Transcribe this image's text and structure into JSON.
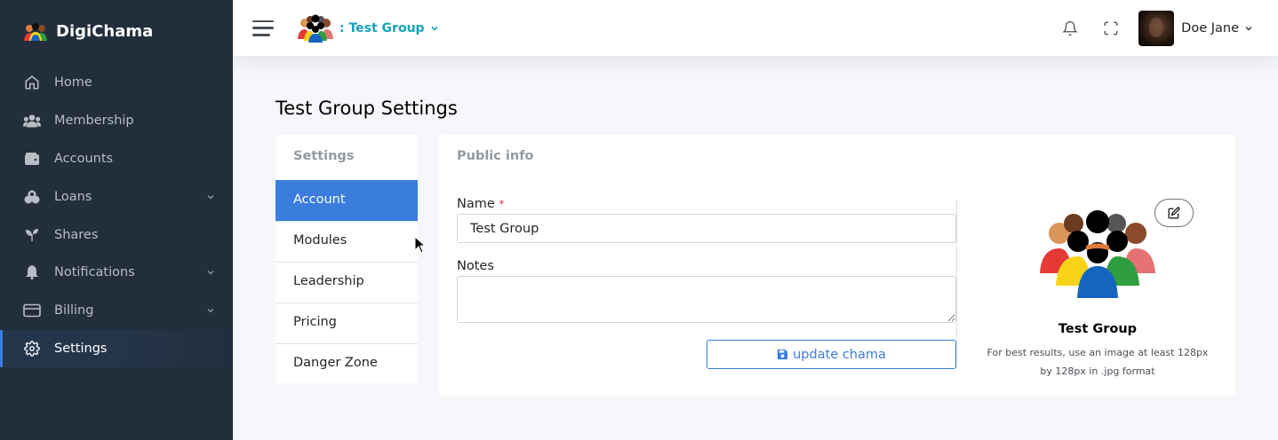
{
  "brand": {
    "name": "DigiChama",
    "logo": "people-group-icon"
  },
  "sidebar": {
    "items": [
      {
        "label": "Home",
        "icon": "home-icon",
        "has_children": false,
        "active": false
      },
      {
        "label": "Membership",
        "icon": "users-icon",
        "has_children": false,
        "active": false
      },
      {
        "label": "Accounts",
        "icon": "wallet-icon",
        "has_children": false,
        "active": false
      },
      {
        "label": "Loans",
        "icon": "coins-icon",
        "has_children": true,
        "active": false
      },
      {
        "label": "Shares",
        "icon": "seedling-icon",
        "has_children": false,
        "active": false
      },
      {
        "label": "Notifications",
        "icon": "bell-icon",
        "has_children": true,
        "active": false
      },
      {
        "label": "Billing",
        "icon": "credit-card-icon",
        "has_children": true,
        "active": false
      },
      {
        "label": "Settings",
        "icon": "gear-icon",
        "has_children": false,
        "active": true
      }
    ]
  },
  "topbar": {
    "group_label": ": Test Group",
    "user_name": "Doe Jane"
  },
  "page": {
    "title": "Test Group Settings"
  },
  "settings_menu": {
    "heading": "Settings",
    "items": [
      "Account",
      "Modules",
      "Leadership",
      "Pricing",
      "Danger Zone"
    ],
    "active": "Account"
  },
  "public_info": {
    "title": "Public info",
    "name_label": "Name",
    "required_mark": "*",
    "name_value": "Test Group",
    "notes_label": "Notes",
    "notes_value": "",
    "update_label": "update chama",
    "group_name": "Test Group",
    "image_hint": "For best results, use an image at least 128px by 128px in .jpg format"
  },
  "colors": {
    "sidebar_bg": "#222e3c",
    "accent": "#3b7ddd",
    "group_link": "#17a2b8",
    "required": "#dc3545"
  }
}
